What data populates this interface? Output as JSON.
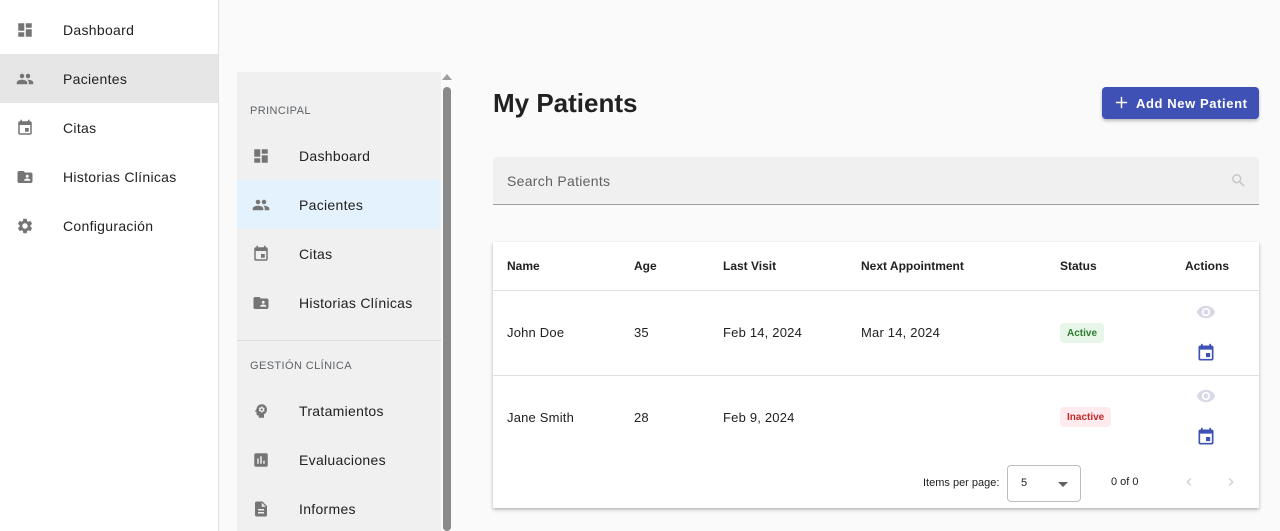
{
  "app_sidebar": {
    "items": [
      {
        "label": "Dashboard",
        "icon": "dashboard-icon"
      },
      {
        "label": "Pacientes",
        "icon": "people-icon",
        "active": true
      },
      {
        "label": "Citas",
        "icon": "calendar-icon"
      },
      {
        "label": "Historias Clínicas",
        "icon": "folder-shared-icon"
      },
      {
        "label": "Configuración",
        "icon": "gear-icon"
      }
    ]
  },
  "sub_sidebar": {
    "sections": [
      {
        "header": "PRINCIPAL",
        "items": [
          {
            "label": "Dashboard",
            "icon": "dashboard-icon"
          },
          {
            "label": "Pacientes",
            "icon": "people-icon",
            "active": true
          },
          {
            "label": "Citas",
            "icon": "calendar-icon"
          },
          {
            "label": "Historias Clínicas",
            "icon": "folder-shared-icon"
          }
        ]
      },
      {
        "header": "GESTIÓN CLÍNICA",
        "items": [
          {
            "label": "Tratamientos",
            "icon": "psychology-icon"
          },
          {
            "label": "Evaluaciones",
            "icon": "bar-chart-icon"
          },
          {
            "label": "Informes",
            "icon": "description-icon"
          }
        ]
      }
    ]
  },
  "main": {
    "title": "My Patients",
    "add_button_label": "Add New Patient",
    "search_placeholder": "Search Patients",
    "table": {
      "columns": [
        "Name",
        "Age",
        "Last Visit",
        "Next Appointment",
        "Status",
        "Actions"
      ],
      "rows": [
        {
          "name": "John Doe",
          "age": "35",
          "last_visit": "Feb 14, 2024",
          "next_appointment": "Mar 14, 2024",
          "status": "Active"
        },
        {
          "name": "Jane Smith",
          "age": "28",
          "last_visit": "Feb 9, 2024",
          "next_appointment": "",
          "status": "Inactive"
        }
      ]
    },
    "paginator": {
      "items_per_page_label": "Items per page:",
      "page_size": "5",
      "range_label": "0 of 0"
    }
  },
  "colors": {
    "primary": "#3f51b5",
    "active_status": "#2e7d32",
    "inactive_status": "#c62828",
    "sub_sidebar_active": "#e3f2fd"
  }
}
